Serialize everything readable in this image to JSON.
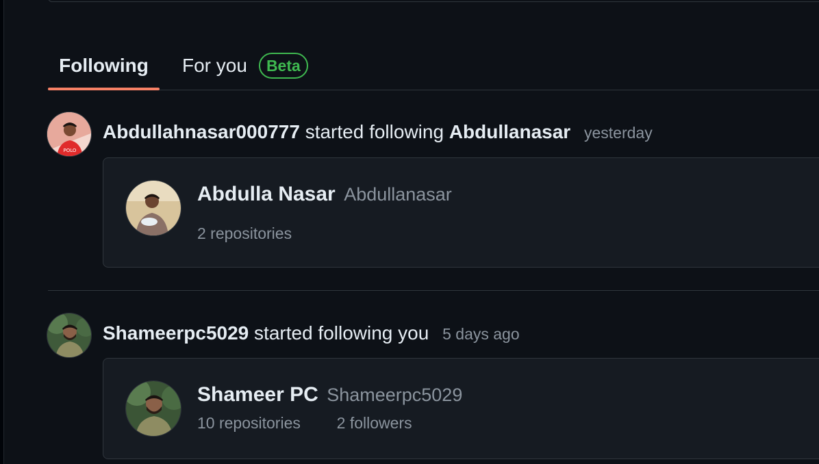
{
  "tabs": {
    "following_label": "Following",
    "foryou_label": "For you",
    "beta_label": "Beta"
  },
  "feed": [
    {
      "actor": "Abdullahnasar000777",
      "action": "started following",
      "target": "Abdullanasar",
      "time": "yesterday",
      "card": {
        "name": "Abdulla Nasar",
        "login": "Abdullanasar",
        "repositories": "2 repositories"
      }
    },
    {
      "actor": "Shameerpc5029",
      "action": "started following",
      "target": "you",
      "time": "5 days ago",
      "card": {
        "name": "Shameer PC",
        "login": "Shameerpc5029",
        "repositories": "10 repositories",
        "followers": "2 followers"
      }
    }
  ],
  "colors": {
    "background": "#0d1117",
    "card": "#161b22",
    "border": "#30363d",
    "tab_underline": "#f78166",
    "beta": "#3fb950",
    "muted": "#8b949e"
  }
}
